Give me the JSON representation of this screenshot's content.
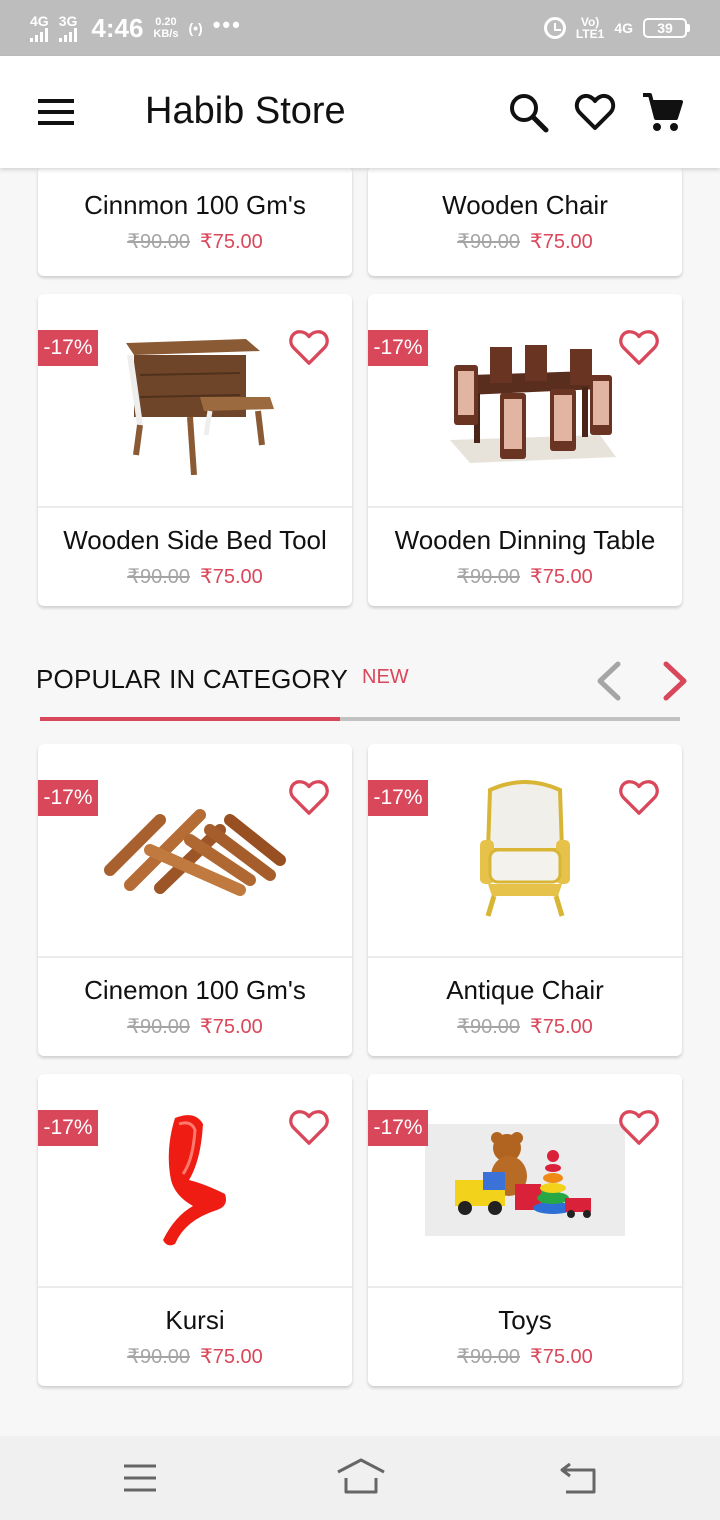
{
  "status_bar": {
    "net1": "4G",
    "net2": "3G",
    "time": "4:46",
    "speed_value": "0.20",
    "speed_unit": "KB/s",
    "hotspot": "(•)",
    "more": "•••",
    "volte_top": "Vo)",
    "volte_bottom": "LTE1",
    "net3": "4G",
    "battery": "39"
  },
  "app_bar": {
    "title": "Habib Store",
    "icons": [
      "menu-icon",
      "search-icon",
      "heart-icon",
      "cart-icon"
    ]
  },
  "top_products": [
    {
      "name": "Cinnmon 100 Gm's",
      "old_price": "₹90.00",
      "price": "₹75.00"
    },
    {
      "name": "Wooden Chair",
      "old_price": "₹90.00",
      "price": "₹75.00"
    }
  ],
  "products_row2": [
    {
      "name": "Wooden Side Bed Tool",
      "old_price": "₹90.00",
      "price": "₹75.00",
      "badge": "-17%",
      "image": "bed-stool"
    },
    {
      "name": "Wooden Dinning Table",
      "old_price": "₹90.00",
      "price": "₹75.00",
      "badge": "-17%",
      "image": "dining-table"
    }
  ],
  "section": {
    "title": "POPULAR IN CATEGORY",
    "tag": "NEW"
  },
  "popular_products": [
    {
      "name": "Cinemon 100 Gm's",
      "old_price": "₹90.00",
      "price": "₹75.00",
      "badge": "-17%",
      "image": "cinnamon"
    },
    {
      "name": "Antique Chair",
      "old_price": "₹90.00",
      "price": "₹75.00",
      "badge": "-17%",
      "image": "antique-chair"
    },
    {
      "name": "Kursi",
      "old_price": "₹90.00",
      "price": "₹75.00",
      "badge": "-17%",
      "image": "red-chair"
    },
    {
      "name": "Toys",
      "old_price": "₹90.00",
      "price": "₹75.00",
      "badge": "-17%",
      "image": "toys"
    }
  ],
  "colors": {
    "accent": "#d9475a",
    "old_price": "#a5a5a5",
    "status_bar": "#bdbdbd"
  },
  "nav_bar": {
    "icons": [
      "recent-apps-icon",
      "home-icon",
      "back-icon"
    ]
  }
}
